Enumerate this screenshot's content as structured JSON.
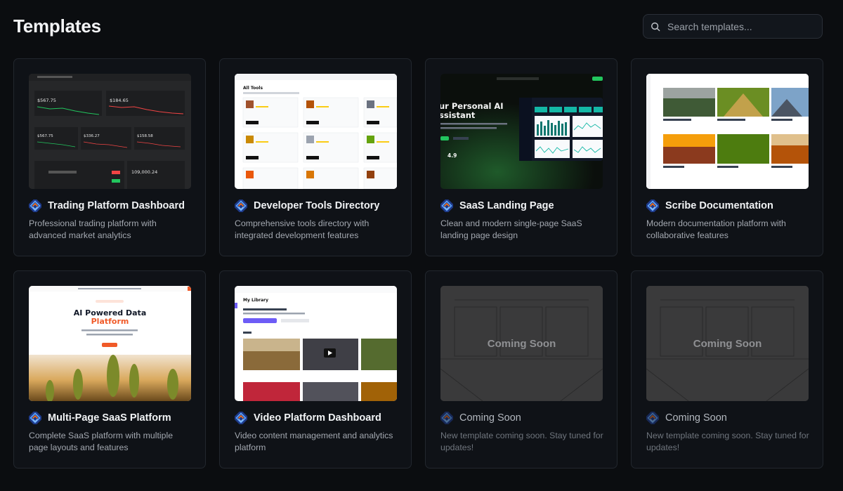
{
  "header": {
    "title": "Templates",
    "search_placeholder": "Search templates..."
  },
  "templates": [
    {
      "title": "Trading Platform Dashboard",
      "desc": "Professional trading platform with advanced market analytics",
      "thumb": {
        "v1": "$567.75",
        "v2": "$184.65",
        "v3": "$567.75",
        "v4": "$336.27",
        "v5": "$158.58",
        "v6": "109,000.24"
      }
    },
    {
      "title": "Developer Tools Directory",
      "desc": "Comprehensive tools directory with integrated development features",
      "thumb": {
        "heading": "All Tools"
      }
    },
    {
      "title": "SaaS Landing Page",
      "desc": "Clean and modern single-page SaaS landing page design",
      "thumb": {
        "hero_line1": "ur Personal AI",
        "hero_line2": "ssistant",
        "rating": "4.9"
      }
    },
    {
      "title": "Scribe Documentation",
      "desc": "Modern documentation platform with collaborative features"
    },
    {
      "title": "Multi-Page SaaS Platform",
      "desc": "Complete SaaS platform with multiple page layouts and features",
      "thumb": {
        "hero_line1": "AI Powered Data",
        "hero_line2": "Platform"
      }
    },
    {
      "title": "Video Platform Dashboard",
      "desc": "Video content management and analytics platform",
      "thumb": {
        "heading": "My Library"
      }
    },
    {
      "title": "Coming Soon",
      "desc": "New template coming soon. Stay tuned for updates!",
      "thumb": {
        "label": "Coming Soon"
      }
    },
    {
      "title": "Coming Soon",
      "desc": "New template coming soon. Stay tuned for updates!",
      "thumb": {
        "label": "Coming Soon"
      }
    }
  ],
  "colors": {
    "background": "#0b0d10",
    "card": "#0f1217",
    "card_border": "#22272e",
    "logo_blue": "#3b82f6",
    "logo_orange": "#f97316",
    "trading_up": "#22c55e",
    "trading_down": "#ef4444",
    "saas_accent": "#2dd4bf",
    "multipage_accent": "#f05a28",
    "video_accent": "#6d5cf6"
  },
  "icons": {
    "search": "search-icon",
    "template_logo": "template-logo-icon"
  }
}
